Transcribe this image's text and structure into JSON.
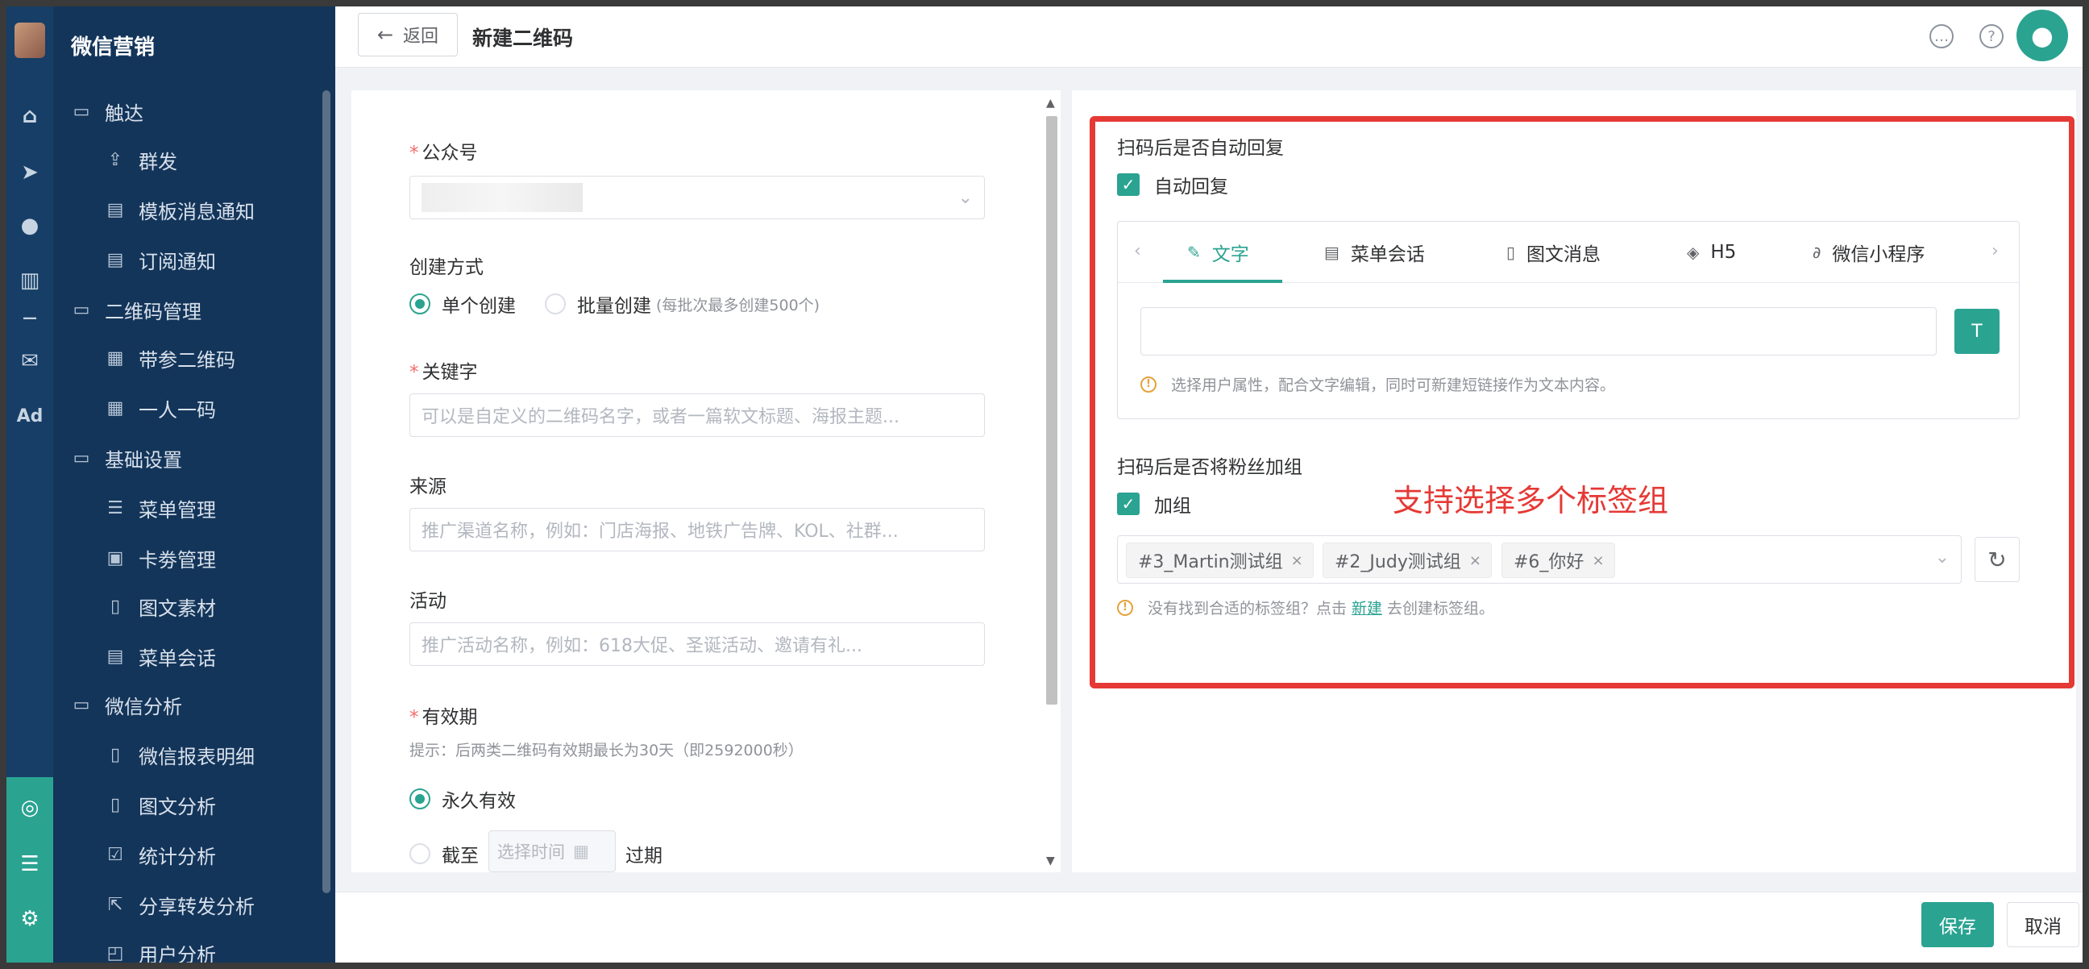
{
  "sidebar": {
    "brand": "微信营销",
    "items": [
      {
        "label": "触达",
        "icon": "folder-icon"
      },
      {
        "label": "群发",
        "icon": "upload-icon"
      },
      {
        "label": "模板消息通知",
        "icon": "template-icon"
      },
      {
        "label": "订阅通知",
        "icon": "template-icon"
      },
      {
        "label": "二维码管理",
        "icon": "folder-icon"
      },
      {
        "label": "带参二维码",
        "icon": "qrcode-icon"
      },
      {
        "label": "一人一码",
        "icon": "qrcode-icon"
      },
      {
        "label": "基础设置",
        "icon": "folder-icon"
      },
      {
        "label": "菜单管理",
        "icon": "list-icon"
      },
      {
        "label": "卡劵管理",
        "icon": "card-icon"
      },
      {
        "label": "图文素材",
        "icon": "document-icon"
      },
      {
        "label": "菜单会话",
        "icon": "chat-icon"
      },
      {
        "label": "微信分析",
        "icon": "folder-icon"
      },
      {
        "label": "微信报表明细",
        "icon": "document-icon"
      },
      {
        "label": "图文分析",
        "icon": "document-icon"
      },
      {
        "label": "统计分析",
        "icon": "chart-icon"
      },
      {
        "label": "分享转发分析",
        "icon": "share-icon"
      },
      {
        "label": "用户分析",
        "icon": "user-icon"
      }
    ]
  },
  "rail": {
    "ad_label": "Ad"
  },
  "header": {
    "back_label": "返回",
    "title": "新建二维码"
  },
  "form": {
    "account_label": "公众号",
    "create_mode_label": "创建方式",
    "single_create": "单个创建",
    "batch_create": "批量创建",
    "batch_hint": "(每批次最多创建500个)",
    "keyword_label": "关键字",
    "keyword_placeholder": "可以是自定义的二维码名字，或者一篇软文标题、海报主题...",
    "source_label": "来源",
    "source_placeholder": "推广渠道名称，例如：门店海报、地铁广告牌、KOL、社群...",
    "activity_label": "活动",
    "activity_placeholder": "推广活动名称，例如：618大促、圣诞活动、邀请有礼...",
    "validity_label": "有效期",
    "validity_hint": "提示：后两类二维码有效期最长为30天（即2592000秒）",
    "forever_label": "永久有效",
    "until_label": "截至",
    "until_placeholder": "选择时间",
    "expire_label": "过期"
  },
  "reply": {
    "section_label": "扫码后是否自动回复",
    "auto_reply_label": "自动回复",
    "tabs": [
      {
        "label": "文字",
        "icon": "pencil-icon"
      },
      {
        "label": "菜单会话",
        "icon": "chat-icon"
      },
      {
        "label": "图文消息",
        "icon": "document-icon"
      },
      {
        "label": "H5",
        "icon": "html5-icon"
      },
      {
        "label": "微信小程序",
        "icon": "link-icon"
      }
    ],
    "hint": "选择用户属性，配合文字编辑，同时可新建短链接作为文本内容。"
  },
  "group": {
    "section_label": "扫码后是否将粉丝加组",
    "add_group_label": "加组",
    "annotation": "支持选择多个标签组",
    "tags": [
      "#3_Martin测试组",
      "#2_Judy测试组",
      "#6_你好"
    ],
    "hint_prefix": "没有找到合适的标签组？点击",
    "hint_link": "新建",
    "hint_suffix": "去创建标签组。"
  },
  "footer": {
    "save_label": "保存",
    "cancel_label": "取消"
  },
  "colors": {
    "accent": "#2aa391",
    "sidebar_bg": "#14355a",
    "annotation_red": "#e53935"
  }
}
